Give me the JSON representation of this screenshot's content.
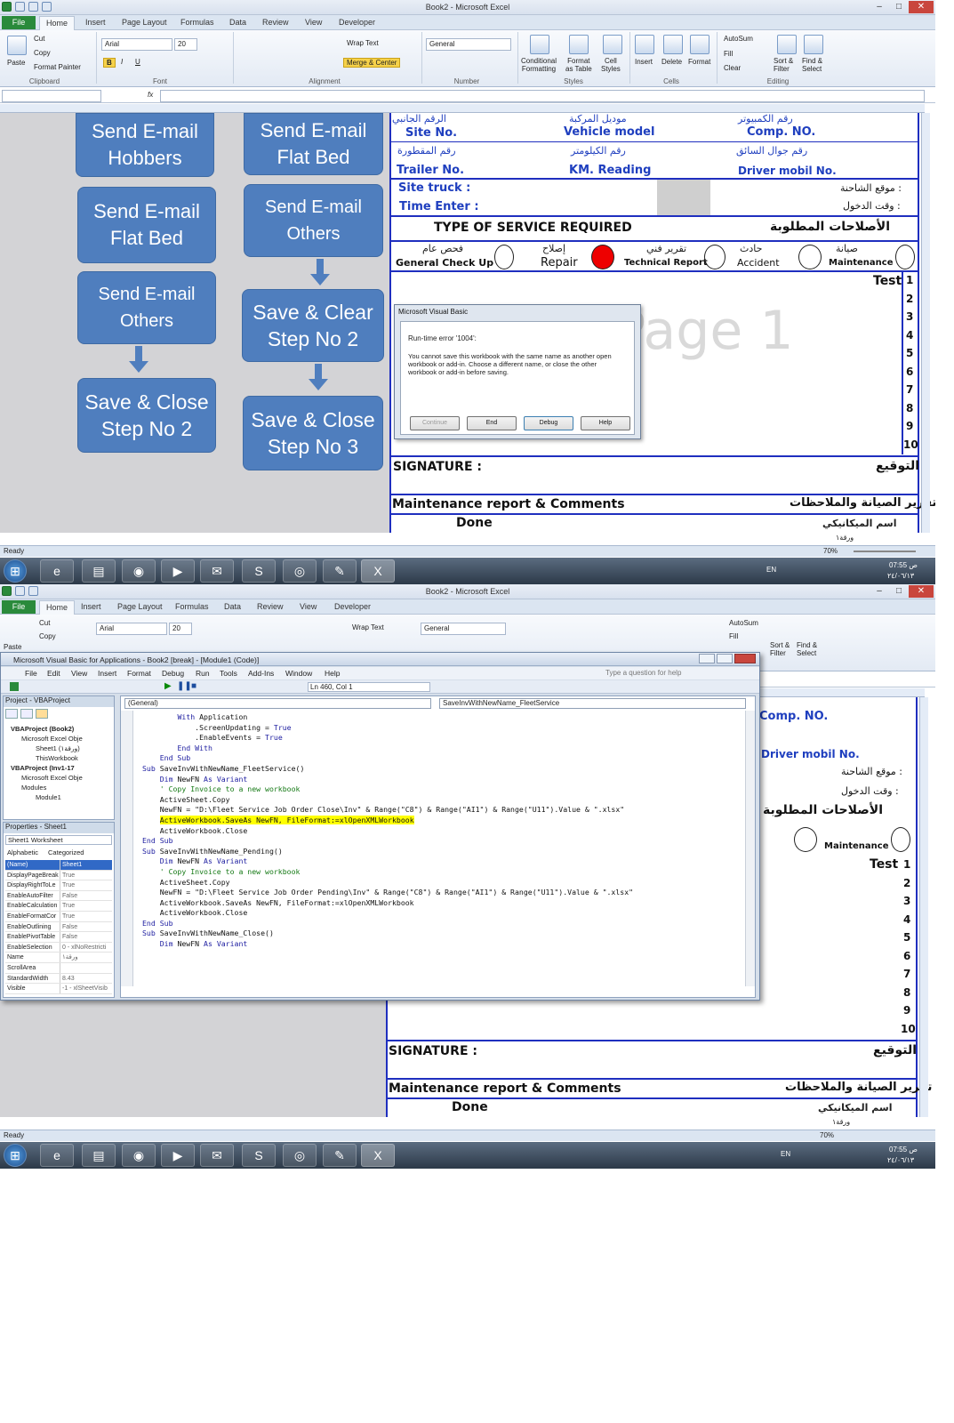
{
  "top": {
    "window_title": "Book2 - Microsoft Excel",
    "tabs": [
      "File",
      "Home",
      "Insert",
      "Page Layout",
      "Formulas",
      "Data",
      "Review",
      "View",
      "Developer"
    ],
    "clipboard": {
      "paste": "Paste",
      "cut": "Cut",
      "copy": "Copy",
      "painter": "Format Painter",
      "group": "Clipboard"
    },
    "font": {
      "name": "Arial",
      "size": "20",
      "group": "Font"
    },
    "alignment": {
      "wrap": "Wrap Text",
      "merge": "Merge & Center",
      "group": "Alignment"
    },
    "number": {
      "format": "General",
      "group": "Number"
    },
    "styles": {
      "cond": "Conditional\nFormatting",
      "table": "Format\nas Table",
      "cell": "Cell\nStyles",
      "group": "Styles"
    },
    "cells": {
      "insert": "Insert",
      "delete": "Delete",
      "format": "Format",
      "group": "Cells"
    },
    "editing": {
      "autosum": "AutoSum",
      "fill": "Fill",
      "clear": "Clear",
      "sort": "Sort &\nFilter",
      "find": "Find &\nSelect",
      "group": "Editing"
    },
    "shapes": [
      {
        "label": "Send E-mail\nHobbers"
      },
      {
        "label": "Send E-mail\nFlat Bed"
      },
      {
        "label": "Send E-mail\nFlat Bed"
      },
      {
        "label": "Send E-mail\nOthers"
      },
      {
        "label": "Send E-mail\nOthers"
      },
      {
        "label": "Save & Clear\nStep No 2"
      },
      {
        "label": "Save & Close\nStep No 2"
      },
      {
        "label": "Save & Close\nStep No 3"
      }
    ],
    "form": {
      "ar_trailer_no": "الرقم الجانبي",
      "site_no": "Site No.",
      "ar_vehicle_model": "موديل المركبة",
      "vehicle_model": "Vehicle model",
      "ar_comp_no": "رقم الكمبيوتر",
      "comp_no": "Comp. NO.",
      "ar_trailer": "رقم المقطورة",
      "trailer_no": "Trailer No.",
      "ar_km": "رقم الكيلومتر",
      "km_reading": "KM. Reading",
      "ar_driver": "رقم جوال السائق",
      "driver_mobil": "Driver mobil No.",
      "site_truck": "Site truck  :",
      "ar_site": "موقع الشاحنة  :",
      "time_enter": "Time Enter :",
      "ar_time": "وقت الدخول  :",
      "service_required": "TYPE OF SERVICE REQUIRED",
      "ar_service": "الأصلاحات المطلوبة",
      "ar_general": "فحص عام",
      "general": "General Check Up",
      "ar_repair": "إصلاح",
      "repair": "Repair",
      "ar_technical": "تقرير فني",
      "technical": "Technical Report",
      "ar_accident": "حادث",
      "accident": "Accident",
      "ar_maintenance": "صيانة",
      "maintenance": "Maintenance",
      "test": "Test",
      "rows": [
        "1",
        "2",
        "3",
        "4",
        "5",
        "6",
        "7",
        "8",
        "9",
        "10"
      ],
      "signature": "SIGNATURE :",
      "ar_signature": "التوقيع",
      "maintenance_report": "Maintenance report  & Comments",
      "ar_report": "تقرير الصيانة والملاحظات",
      "done": "Done",
      "ar_mechanic": "اسم الميكانيكي",
      "watermark": "Page 1"
    },
    "dialog": {
      "title": "Microsoft Visual Basic",
      "error": "Run-time error '1004':",
      "message": "You cannot save this workbook with the same name as another open workbook or add-in. Choose a different name, or close the other workbook or add-in before saving.",
      "buttons": [
        "Continue",
        "End",
        "Debug",
        "Help"
      ]
    },
    "status": {
      "ready": "Ready",
      "zoom": "70%",
      "sheet_tab": "ورقة١"
    },
    "clock": {
      "lang": "EN",
      "time": "07:55 ص",
      "date": "٢٤/٠٦/١٣"
    }
  },
  "bottom": {
    "window_title": "Book2 - Microsoft Excel",
    "vbe_title": "Microsoft Visual Basic for Applications - Book2 [break] - [Module1 (Code)]",
    "menu": [
      "File",
      "Edit",
      "View",
      "Insert",
      "Format",
      "Debug",
      "Run",
      "Tools",
      "Add-Ins",
      "Window",
      "Help"
    ],
    "help_placeholder": "Type a question for help",
    "position": "Ln 460, Col 1",
    "project_title": "Project - VBAProject",
    "tree": [
      "VBAProject (Book2)",
      "Microsoft Excel Obje",
      "Sheet1 (ورقة١)",
      "ThisWorkbook",
      "VBAProject (Inv1-17",
      "Microsoft Excel Obje",
      "Modules",
      "Module1"
    ],
    "props_title": "Properties - Sheet1",
    "props_object": "Sheet1 Worksheet",
    "props_tabs": [
      "Alphabetic",
      "Categorized"
    ],
    "props": [
      [
        "(Name)",
        "Sheet1"
      ],
      [
        "DisplayPageBreak",
        "True"
      ],
      [
        "DisplayRightToLe",
        "True"
      ],
      [
        "EnableAutoFilter",
        "False"
      ],
      [
        "EnableCalculation",
        "True"
      ],
      [
        "EnableFormatCor",
        "True"
      ],
      [
        "EnableOutlining",
        "False"
      ],
      [
        "EnablePivotTable",
        "False"
      ],
      [
        "EnableSelection",
        "0 - xlNoRestricti"
      ],
      [
        "Name",
        "ورقة١"
      ],
      [
        "ScrollArea",
        ""
      ],
      [
        "StandardWidth",
        "8.43"
      ],
      [
        "Visible",
        "-1 - xlSheetVisib"
      ]
    ],
    "combo_left": "(General)",
    "combo_right": "SaveInvWithNewName_FleetService",
    "code": [
      "        With Application",
      "            .ScreenUpdating = True",
      "            .EnableEvents = True",
      "        End With",
      "",
      "    End Sub",
      "",
      "",
      "Sub SaveInvWithNewName_FleetService()",
      "    Dim NewFN As Variant",
      "    ' Copy Invoice to a new workbook",
      "    ActiveSheet.Copy",
      "    NewFN = \"D:\\Fleet Service Job Order Close\\Inv\" & Range(\"C8\") & Range(\"AI1\") & Range(\"U11\").Value & \".xlsx\"",
      "    ActiveWorkbook.SaveAs NewFN, FileFormat:=xlOpenXMLWorkbook",
      "    ActiveWorkbook.Close",
      "End Sub",
      "",
      "Sub SaveInvWithNewName_Pending()",
      "    Dim NewFN As Variant",
      "    ' Copy Invoice to a new workbook",
      "    ActiveSheet.Copy",
      "    NewFN = \"D:\\Fleet Service Job Order Pending\\Inv\" & Range(\"C8\") & Range(\"AI1\") & Range(\"U11\").Value & \".xlsx\"",
      "    ActiveWorkbook.SaveAs NewFN, FileFormat:=xlOpenXMLWorkbook",
      "    ActiveWorkbook.Close",
      "End Sub",
      "Sub SaveInvWithNewName_Close()",
      "    Dim NewFN As Variant"
    ],
    "highlight_line": 13,
    "status": {
      "ready": "Ready",
      "zoom": "70%",
      "sheet_tab": "ورقة١"
    },
    "clock": {
      "lang": "EN",
      "time": "07:55 ص",
      "date": "٢٤/٠٦/١٣"
    }
  }
}
